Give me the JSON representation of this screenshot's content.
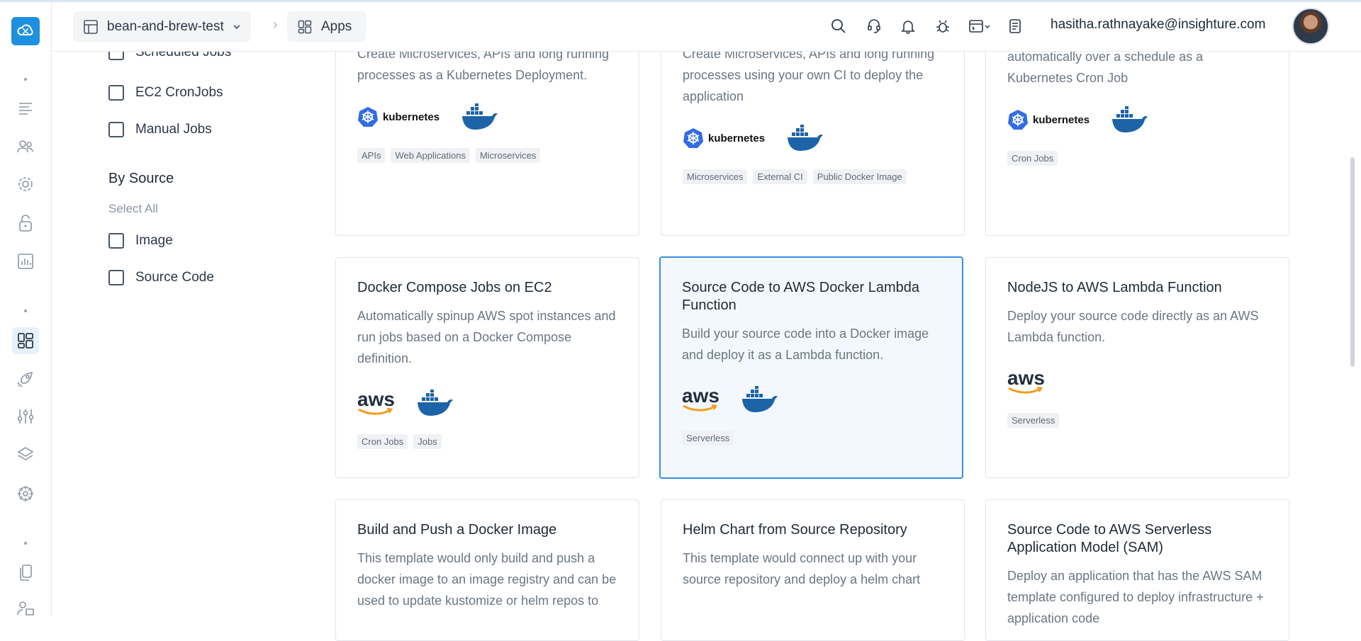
{
  "header": {
    "project": "bean-and-brew-test",
    "section": "Apps",
    "user_email": "hasitha.rathnayake@insighture.com"
  },
  "sidebar": {
    "icons": [
      "home-cloud-icon",
      "list-icon",
      "users-icon",
      "settings-icon",
      "lock-icon",
      "chart-icon",
      "apps-icon",
      "rocket-icon",
      "sliders-icon",
      "layers-icon",
      "helm-icon",
      "docs-icon",
      "org-icon"
    ]
  },
  "filters": {
    "type_items": [
      "Scheduled Jobs",
      "EC2 CronJobs",
      "Manual Jobs"
    ],
    "source_title": "By Source",
    "select_all": "Select All",
    "source_items": [
      "Image",
      "Source Code"
    ]
  },
  "cards": [
    {
      "desc": "Create Microservices, APIs and long running processes as a Kubernetes Deployment.",
      "tags": [
        "APIs",
        "Web Applications",
        "Microservices"
      ]
    },
    {
      "desc": "Create Microservices, APIs and long running processes using your own CI to deploy the application",
      "tags": [
        "Microservices",
        "External CI",
        "Public Docker Image"
      ]
    },
    {
      "desc": "automatically over a schedule as a Kubernetes Cron Job",
      "tags": [
        "Cron Jobs"
      ]
    },
    {
      "title": "Docker Compose Jobs on EC2",
      "desc": "Automatically spinup AWS spot instances and run jobs based on a Docker Compose definition.",
      "tags": [
        "Cron Jobs",
        "Jobs"
      ]
    },
    {
      "title": "Source Code to AWS Docker Lambda Function",
      "desc": "Build your source code into a Docker image and deploy it as a Lambda function.",
      "tags": [
        "Serverless"
      ]
    },
    {
      "title": "NodeJS to AWS Lambda Function",
      "desc": "Deploy your source code directly as an AWS Lambda function.",
      "tags": [
        "Serverless"
      ]
    },
    {
      "title": "Build and Push a Docker Image",
      "desc": "This template would only build and push a docker image to an image registry and can be used to update kustomize or helm repos to"
    },
    {
      "title": "Helm Chart from Source Repository",
      "desc": "This template would connect up with your source repository and deploy a helm chart"
    },
    {
      "title": "Source Code to AWS Serverless Application Model (SAM)",
      "desc": "Deploy an application that has the AWS SAM template configured to deploy infrastructure + application code"
    }
  ],
  "logo_text": {
    "kubernetes": "kubernetes",
    "aws": "aws"
  },
  "colors": {
    "accent": "#1e90e0",
    "selected_border": "#3a8ee0",
    "docker_blue": "#1d63a8",
    "aws_orange": "#f59b1a",
    "k8s_blue": "#326ce5"
  }
}
